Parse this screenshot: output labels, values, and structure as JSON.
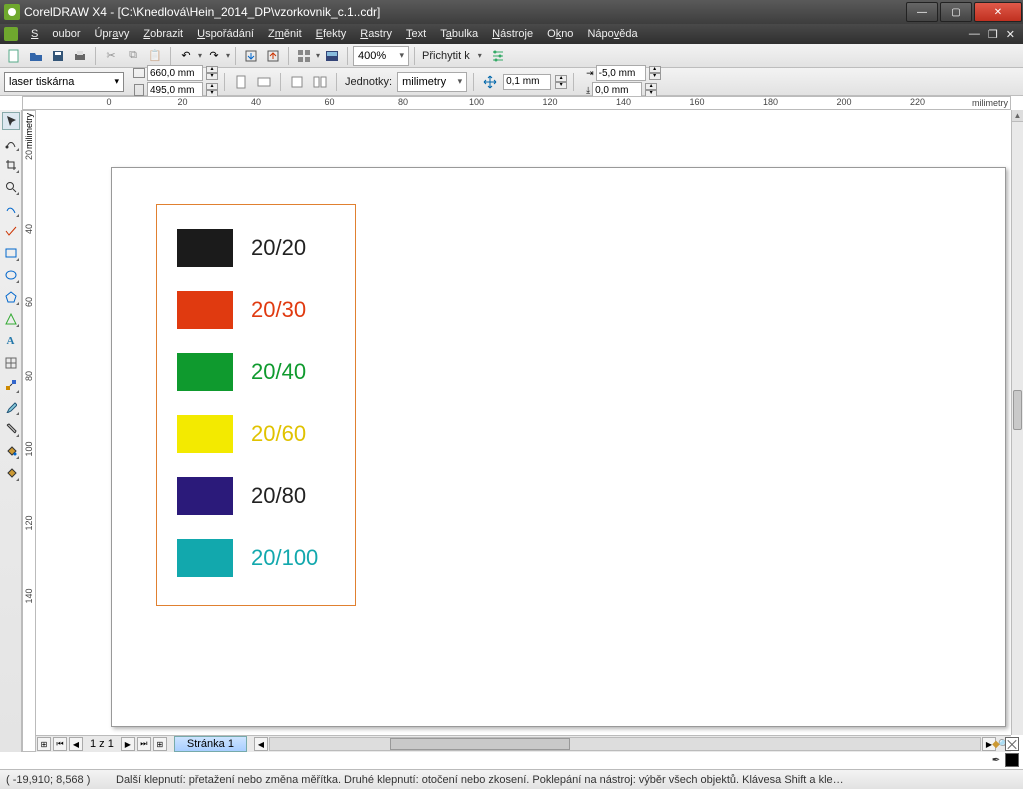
{
  "window": {
    "title": "CorelDRAW X4 - [C:\\Knedlová\\Hein_2014_DP\\vzorkovnik_c.1..cdr]"
  },
  "menu": {
    "items": [
      "Soubor",
      "Úpravy",
      "Zobrazit",
      "Uspořádání",
      "Změnit",
      "Efekty",
      "Rastry",
      "Text",
      "Tabulka",
      "Nástroje",
      "Okno",
      "Nápověda"
    ]
  },
  "toolbar1": {
    "zoom": "400%",
    "snap_label": "Přichytit k"
  },
  "propbar": {
    "preset": "laser tiskárna",
    "page_w": "660,0 mm",
    "page_h": "495,0 mm",
    "units_label": "Jednotky:",
    "units_value": "milimetry",
    "nudge": "0,1 mm",
    "dup_x": "-5,0 mm",
    "dup_y": "0,0 mm"
  },
  "ruler": {
    "h_labels": [
      "0",
      "20",
      "40",
      "60",
      "80",
      "100",
      "120",
      "140",
      "160",
      "180",
      "200",
      "220"
    ],
    "h_unit": "milimetry",
    "v_labels": [
      "20",
      "40",
      "60",
      "80",
      "100",
      "120",
      "140"
    ],
    "v_unit": "milimetry"
  },
  "swatches": [
    {
      "color": "#1b1b1b",
      "label": "20/20",
      "text": "#222222"
    },
    {
      "color": "#e03a10",
      "label": "20/30",
      "text": "#e03a10"
    },
    {
      "color": "#0f9a2e",
      "label": "20/40",
      "text": "#0f9a2e"
    },
    {
      "color": "#f3ea00",
      "label": "20/60",
      "text": "#e0c200"
    },
    {
      "color": "#2b1a7a",
      "label": "20/80",
      "text": "#222222"
    },
    {
      "color": "#12a8ad",
      "label": "20/100",
      "text": "#12a8ad"
    }
  ],
  "page_nav": {
    "counter": "1 z 1",
    "tab": "Stránka 1"
  },
  "status": {
    "coords": "( -19,910; 8,568 )",
    "hint": "Další klepnutí: přetažení nebo změna měřítka. Druhé klepnutí: otočení nebo zkosení. Poklepání na nástroj: výběr všech objektů. Klávesa Shift a kle…"
  }
}
